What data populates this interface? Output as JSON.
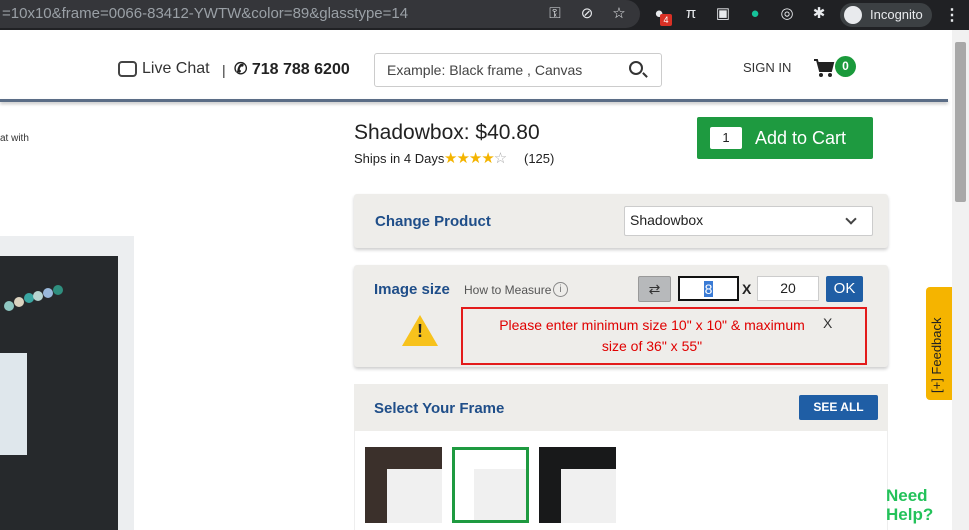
{
  "browser": {
    "url": "=10x10&frame=0066-83412-YWTW&color=89&glasstype=14",
    "extension_badge": "4",
    "incognito_label": "Incognito"
  },
  "header": {
    "live_chat": "Live Chat",
    "separator": "|",
    "phone": "718 788 6200",
    "search_placeholder": "Example: Black frame , Canvas",
    "sign_in": "SIGN IN",
    "cart_count": "0"
  },
  "left": {
    "snippet": "at  with"
  },
  "product": {
    "title": "Shadowbox: $40.80",
    "ships": "Ships in 4 Days",
    "rating": 4,
    "stars_filled": "★★★★",
    "stars_empty": "☆",
    "reviews": "(125)",
    "quantity": "1",
    "add_to_cart": "Add to Cart"
  },
  "change_product": {
    "title": "Change Product",
    "selected": "Shadowbox"
  },
  "image_size": {
    "title": "Image size",
    "how_to_measure": "How to Measure",
    "info": "i",
    "width": "8",
    "x": "X",
    "height": "20",
    "ok": "OK",
    "error_line1": "Please enter minimum size 10\" x 10\" & maximum",
    "error_line2": "size of 36\" x 55\"",
    "error_close": "X",
    "warn_mark": "!"
  },
  "select_frame": {
    "title": "Select Your Frame",
    "see_all": "SEE ALL"
  },
  "feedback": "[+] Feedback",
  "need_help_1": "Need",
  "need_help_2": "Help?",
  "colors": {
    "accent_green": "#1e9a40",
    "accent_blue": "#1f5ea5",
    "error_red": "#e31b1b",
    "feedback_yellow": "#f5b400"
  }
}
